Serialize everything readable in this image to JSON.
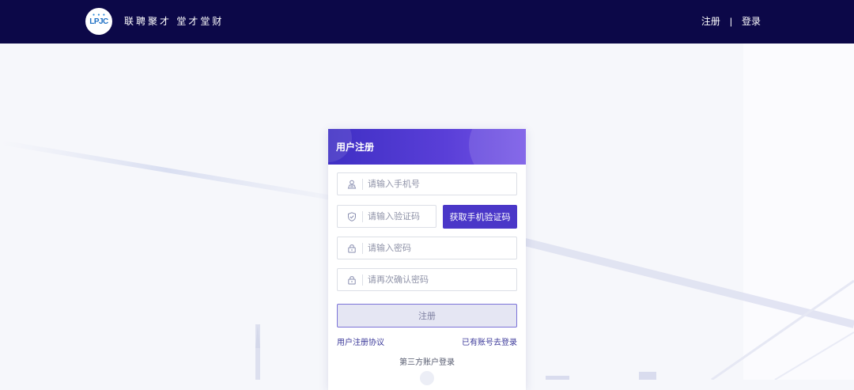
{
  "header": {
    "logo_text": "LPJC",
    "slogan": "联聘聚才 堂才堂财",
    "nav": {
      "register": "注册",
      "separator": "|",
      "login": "登录"
    }
  },
  "form": {
    "title": "用户注册",
    "phone_placeholder": "请输入手机号",
    "code_placeholder": "请输入验证码",
    "get_code_label": "获取手机验证码",
    "password_placeholder": "请输入密码",
    "confirm_placeholder": "请再次确认密码",
    "submit_label": "注册",
    "agreement_link": "用户注册协议",
    "login_link": "已有账号去登录",
    "third_party_label": "第三方账户登录"
  },
  "icons": {
    "phone": "user-icon",
    "code": "shield-icon",
    "password": "lock-icon",
    "confirm": "lock-icon"
  },
  "colors": {
    "topbar": "#0c0848",
    "accent": "#4a37c8",
    "link": "#3c3a9a"
  }
}
